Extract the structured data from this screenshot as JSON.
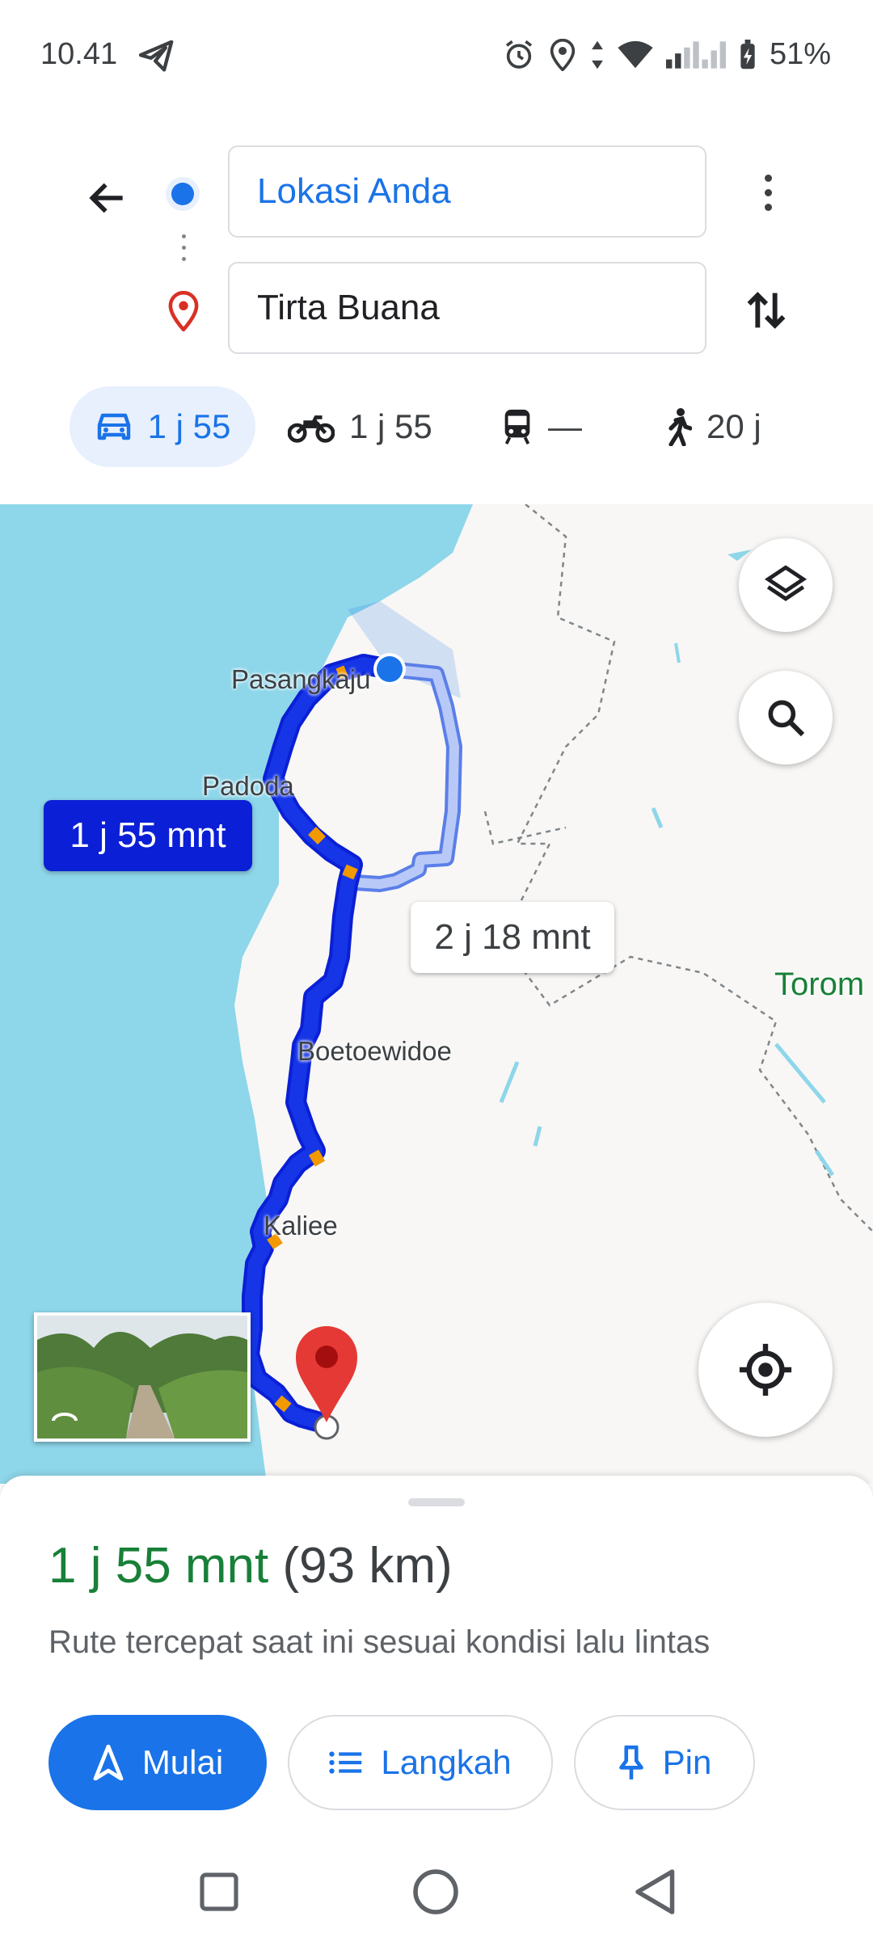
{
  "status_bar": {
    "time": "10.41",
    "battery": "51%",
    "icons": [
      "telegram-icon",
      "alarm-icon",
      "location-icon",
      "data-arrows-icon",
      "wifi-icon",
      "signal-icon",
      "battery-icon"
    ]
  },
  "directions": {
    "origin": "Lokasi Anda",
    "destination": "Tirta Buana",
    "colors": {
      "accent": "#1a73e8",
      "pin": "#d93025"
    }
  },
  "modes": [
    {
      "icon": "car-icon",
      "label": "1 j 55",
      "active": true
    },
    {
      "icon": "motorcycle-icon",
      "label": "1 j 55",
      "active": false
    },
    {
      "icon": "transit-icon",
      "label": "—",
      "active": false
    },
    {
      "icon": "walk-icon",
      "label": "20 j",
      "active": false
    }
  ],
  "map": {
    "place_labels": [
      "Pasangkaju",
      "Padoda",
      "Boetoewidoe",
      "Kaliee",
      "Torom"
    ],
    "primary_route_time": "1 j 55 mnt",
    "alt_route_time": "2 j 18 mnt",
    "colors": {
      "water": "#8ed6ea",
      "route": "#1530d9",
      "alt_route": "#a8bdf5"
    }
  },
  "sheet": {
    "duration": "1 j 55 mnt",
    "distance": "(93 km)",
    "subtitle": "Rute tercepat saat ini sesuai kondisi lalu lintas",
    "start_label": "Mulai",
    "steps_label": "Langkah",
    "pin_label": "Pin",
    "colors": {
      "duration": "#188038"
    }
  }
}
